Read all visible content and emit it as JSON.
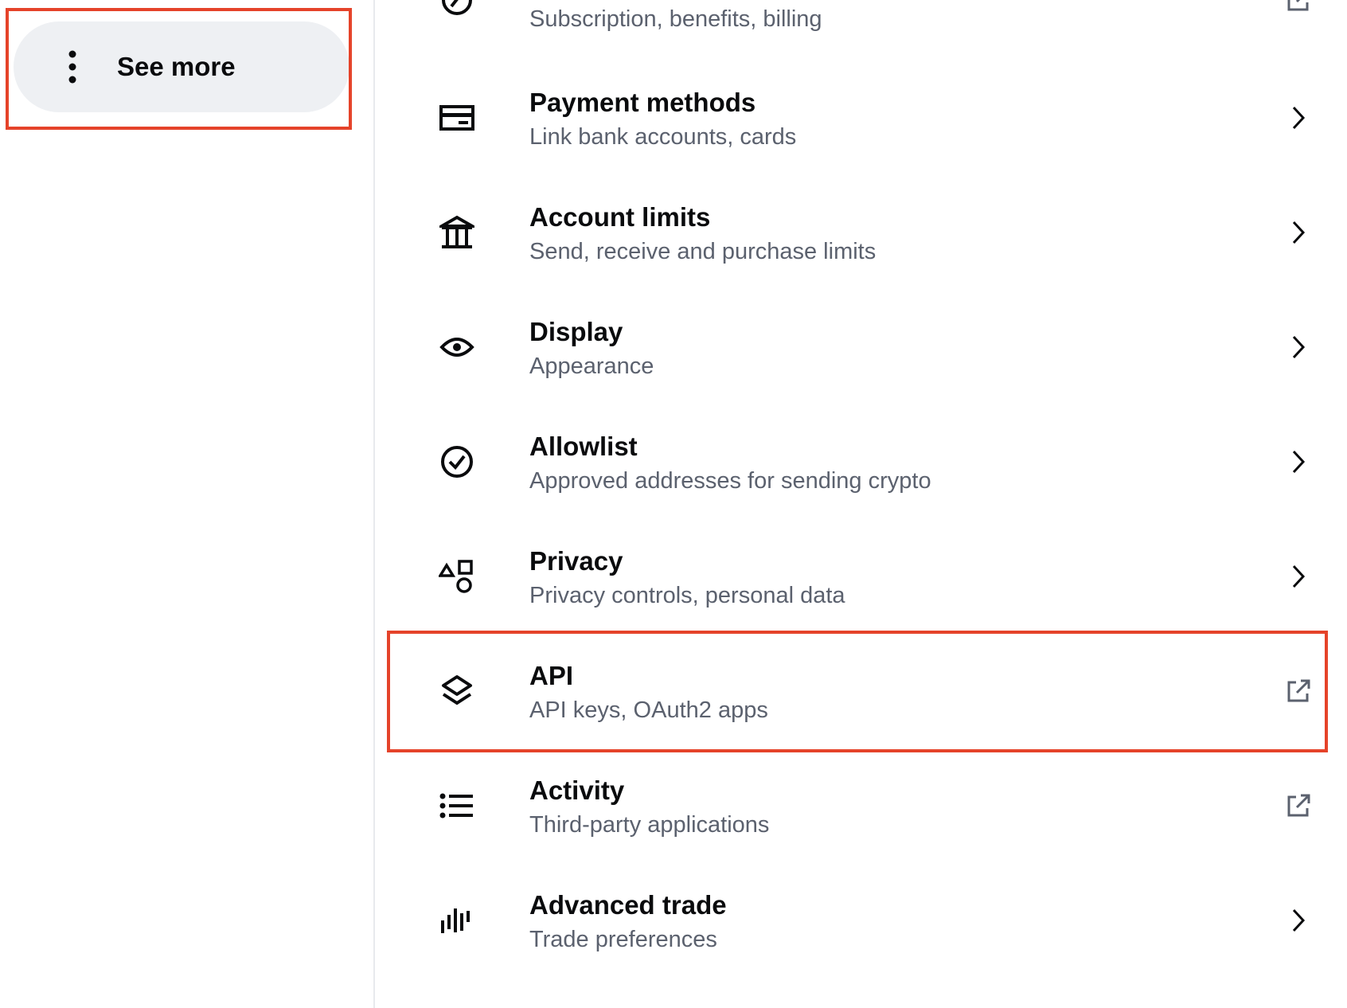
{
  "sidebar": {
    "see_more": {
      "label": "See more",
      "icon": "vertical-dots-icon"
    }
  },
  "settings": {
    "items": [
      {
        "key": "subscription",
        "title": "",
        "subtitle": "Subscription, benefits, billing",
        "icon": "subscription-icon",
        "trailing": "external-link-icon"
      },
      {
        "key": "payment-methods",
        "title": "Payment methods",
        "subtitle": "Link bank accounts, cards",
        "icon": "card-icon",
        "trailing": "chevron-right-icon"
      },
      {
        "key": "account-limits",
        "title": "Account limits",
        "subtitle": "Send, receive and purchase limits",
        "icon": "bank-icon",
        "trailing": "chevron-right-icon"
      },
      {
        "key": "display",
        "title": "Display",
        "subtitle": "Appearance",
        "icon": "eye-icon",
        "trailing": "chevron-right-icon"
      },
      {
        "key": "allowlist",
        "title": "Allowlist",
        "subtitle": "Approved addresses for sending crypto",
        "icon": "check-circle-icon",
        "trailing": "chevron-right-icon"
      },
      {
        "key": "privacy",
        "title": "Privacy",
        "subtitle": "Privacy controls, personal data",
        "icon": "shapes-icon",
        "trailing": "chevron-right-icon"
      },
      {
        "key": "api",
        "title": "API",
        "subtitle": "API keys, OAuth2 apps",
        "icon": "layers-icon",
        "trailing": "external-link-icon"
      },
      {
        "key": "activity",
        "title": "Activity",
        "subtitle": "Third-party applications",
        "icon": "list-icon",
        "trailing": "external-link-icon"
      },
      {
        "key": "advanced-trade",
        "title": "Advanced trade",
        "subtitle": "Trade preferences",
        "icon": "trade-bars-icon",
        "trailing": "chevron-right-icon"
      }
    ]
  },
  "colors": {
    "highlight": "#e5432a",
    "pill_bg": "#eef0f3",
    "subtitle": "#5b616e",
    "text": "#0a0b0d"
  }
}
